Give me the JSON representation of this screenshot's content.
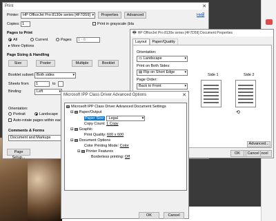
{
  "print": {
    "title": "Print",
    "printer_label": "Printer:",
    "printer_value": "HP OfficeJet Pro 8130e series [4F7D59]",
    "properties_btn": "Properties",
    "advanced_btn": "Advanced",
    "help_link": "Help",
    "copies_label": "Copies:",
    "copies_value": "1",
    "grayscale_label": "Print in grayscale (bla",
    "pages_header": "Pages to Print",
    "all_label": "All",
    "current_label": "Current",
    "pages_label": "Pages",
    "pages_value": "1 - 6",
    "more_options": "More Options",
    "sizing_header": "Page Sizing & Handling",
    "size_btn": "Size",
    "poster_btn": "Poster",
    "multiple_btn": "Multiple",
    "booklet_btn": "Booklet",
    "booklet_subset_label": "Booklet subset:",
    "booklet_subset_value": "Both sides",
    "sheets_from_label": "Sheets from",
    "sheets_from_value": "1",
    "to_label": "to",
    "binding_label": "Binding:",
    "binding_value": "Left",
    "orientation_label": "Orientation:",
    "portrait_label": "Portrait",
    "landscape_label": "Landscape",
    "auto_rotate_label": "Auto-rotate pages within each sh",
    "comments_header": "Comments & Forms",
    "comments_value": "Document and Markups",
    "page_setup_btn": "Page Setup..."
  },
  "props": {
    "title": "HP OfficeJet Pro 8130e series [4F7D59] Document Properties",
    "tab_layout": "Layout",
    "tab_paper": "Paper/Quality",
    "orientation_label": "Orientation:",
    "orientation_value": "Landscape",
    "both_sides_label": "Print on Both Sides:",
    "both_sides_value": "Flip on Short Edge",
    "page_order_label": "Page Order:",
    "page_order_value": "Back to Front",
    "side1": "Side 1",
    "side2": "Side 2",
    "advanced_btn": "Advanced...",
    "ok_btn": "OK",
    "cancel_btn": "Cancel"
  },
  "adv": {
    "title": "Microsoft IPP Class Driver Advanced Options",
    "root": "Microsoft IPP Class Driver Advanced Document Settings",
    "paper_output": "Paper/Output",
    "paper_size_label": "Paper Size:",
    "paper_size_value": "Legal",
    "copy_count_label": "Copy Count:",
    "copy_count_value": "1 Copy",
    "graphic": "Graphic",
    "print_quality_label": "Print Quality:",
    "print_quality_value": "600 x 600",
    "doc_options": "Document Options",
    "color_mode_label": "Color Printing Mode:",
    "color_mode_value": "Color",
    "printer_features": "Printer Features",
    "borderless_label": "Borderless printing:",
    "borderless_value": "Off",
    "ok_btn": "OK",
    "cancel_btn": "Cancel"
  },
  "bottom": {
    "ok_btn": "OK",
    "cancel_btn": "Cancel"
  }
}
